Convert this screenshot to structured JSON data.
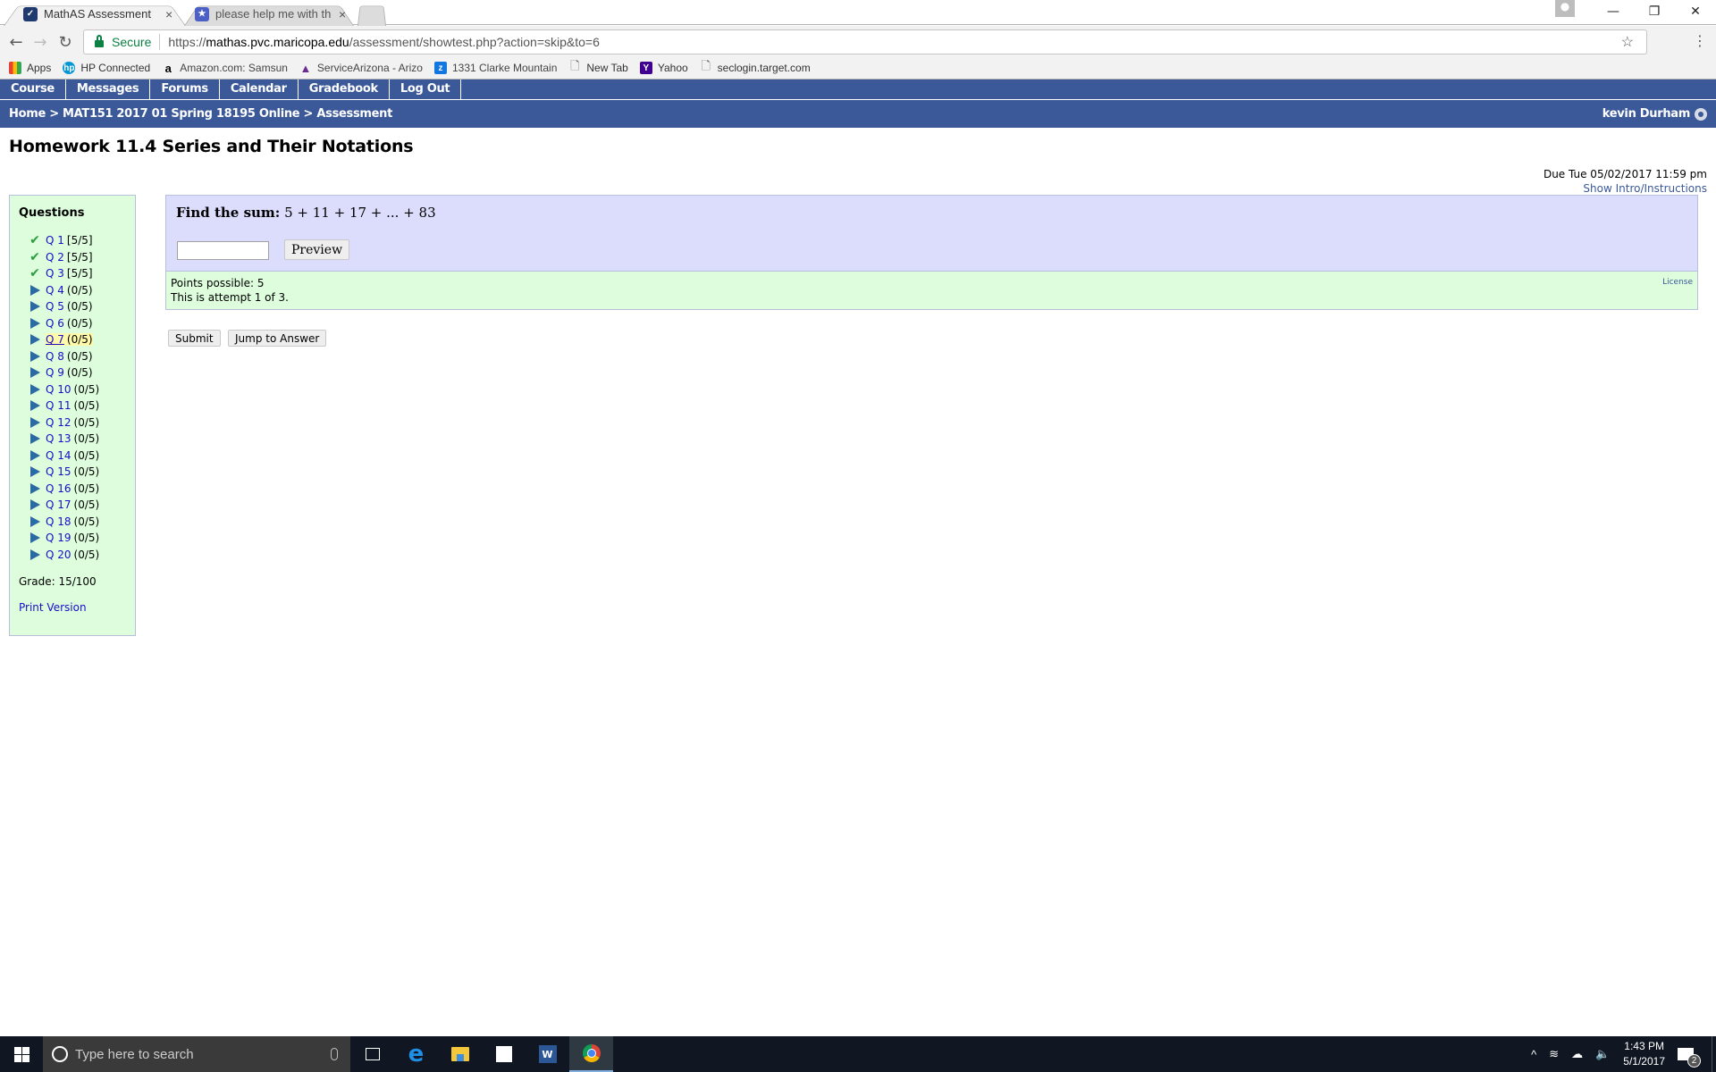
{
  "browser": {
    "tabs": [
      {
        "title": "MathAS Assessment",
        "favicon": "mathas-icon",
        "active": true
      },
      {
        "title": "please help me with the",
        "favicon": "chegg-icon",
        "active": false
      }
    ],
    "close_glyph": "×",
    "address": {
      "secure_label": "Secure",
      "scheme": "https://",
      "host": "mathas.pvc.maricopa.edu",
      "path": "/assessment/showtest.php?action=skip&to=6"
    },
    "bookmarks": [
      {
        "label": "Apps",
        "icon": "apps-grid-icon",
        "color": "#e94235"
      },
      {
        "label": "HP Connected",
        "icon": "hp-icon",
        "color": "#0096d6"
      },
      {
        "label": "Amazon.com: Samsun",
        "icon": "amazon-icon",
        "color": "#ffffff"
      },
      {
        "label": "ServiceArizona - Arizo",
        "icon": "servicearizona-icon",
        "color": "#ffffff"
      },
      {
        "label": "1331 Clarke Mountain",
        "icon": "zillow-icon",
        "color": "#1277e1"
      },
      {
        "label": "New Tab",
        "icon": "page-icon",
        "color": "#ffffff"
      },
      {
        "label": "Yahoo",
        "icon": "yahoo-icon",
        "color": "#400090"
      },
      {
        "label": "seclogin.target.com",
        "icon": "page-icon",
        "color": "#ffffff"
      }
    ]
  },
  "nav": {
    "items": [
      "Course",
      "Messages",
      "Forums",
      "Calendar",
      "Gradebook",
      "Log Out"
    ]
  },
  "breadcrumb": {
    "text": "Home > MAT151 2017 01 Spring 18195 Online > Assessment",
    "user": "kevin Durham"
  },
  "page": {
    "title": "Homework 11.4 Series and Their Notations",
    "due": "Due Tue 05/02/2017 11:59 pm",
    "show_intro": "Show Intro/Instructions"
  },
  "sidebar": {
    "heading": "Questions",
    "questions": [
      {
        "label": "Q 1",
        "score": "[5/5]",
        "status": "complete"
      },
      {
        "label": "Q 2",
        "score": "[5/5]",
        "status": "complete"
      },
      {
        "label": "Q 3",
        "score": "[5/5]",
        "status": "complete"
      },
      {
        "label": "Q 4",
        "score": "(0/5)",
        "status": "open"
      },
      {
        "label": "Q 5",
        "score": "(0/5)",
        "status": "open"
      },
      {
        "label": "Q 6",
        "score": "(0/5)",
        "status": "open"
      },
      {
        "label": "Q 7",
        "score": "(0/5)",
        "status": "current"
      },
      {
        "label": "Q 8",
        "score": "(0/5)",
        "status": "open"
      },
      {
        "label": "Q 9",
        "score": "(0/5)",
        "status": "open"
      },
      {
        "label": "Q 10",
        "score": "(0/5)",
        "status": "open"
      },
      {
        "label": "Q 11",
        "score": "(0/5)",
        "status": "open"
      },
      {
        "label": "Q 12",
        "score": "(0/5)",
        "status": "open"
      },
      {
        "label": "Q 13",
        "score": "(0/5)",
        "status": "open"
      },
      {
        "label": "Q 14",
        "score": "(0/5)",
        "status": "open"
      },
      {
        "label": "Q 15",
        "score": "(0/5)",
        "status": "open"
      },
      {
        "label": "Q 16",
        "score": "(0/5)",
        "status": "open"
      },
      {
        "label": "Q 17",
        "score": "(0/5)",
        "status": "open"
      },
      {
        "label": "Q 18",
        "score": "(0/5)",
        "status": "open"
      },
      {
        "label": "Q 19",
        "score": "(0/5)",
        "status": "open"
      },
      {
        "label": "Q 20",
        "score": "(0/5)",
        "status": "open"
      }
    ],
    "grade": "Grade: 15/100",
    "print_version": "Print Version"
  },
  "question": {
    "prompt_bold": "Find the sum:",
    "expression": "5 + 11 + 17 + ... + 83",
    "answer_value": "",
    "preview_label": "Preview",
    "points": "Points possible: 5",
    "attempt": "This is attempt 1 of 3.",
    "license": "License"
  },
  "actions": {
    "submit": "Submit",
    "jump": "Jump to Answer"
  },
  "taskbar": {
    "search_placeholder": "Type here to search",
    "time": "1:43 PM",
    "date": "5/1/2017",
    "notifications": "2"
  }
}
